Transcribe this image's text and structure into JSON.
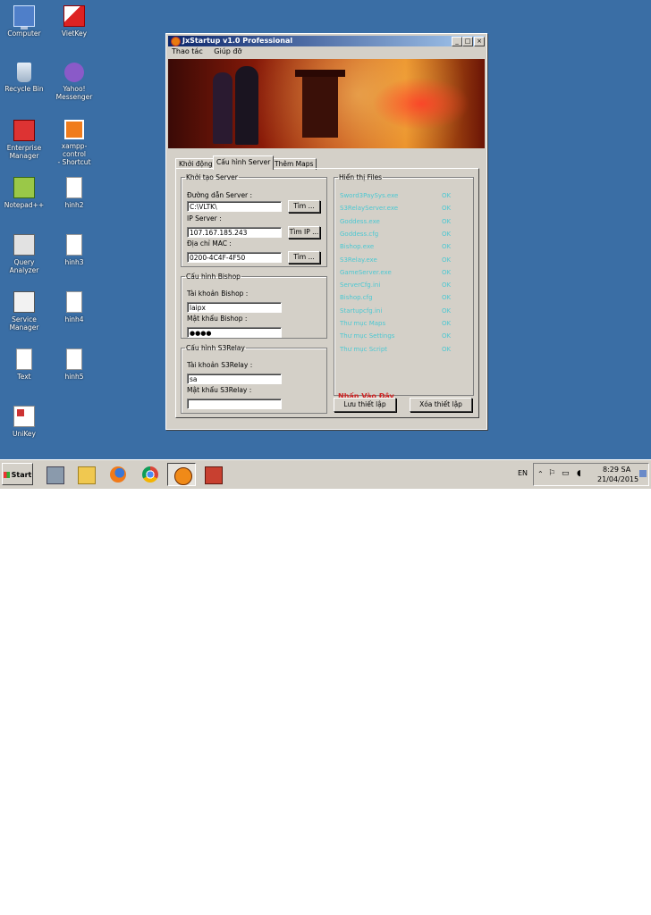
{
  "desktop_icons": [
    {
      "label": "Computer",
      "icon": "computer-icon"
    },
    {
      "label": "VietKey",
      "icon": "vietkey-icon"
    },
    {
      "label": "Recycle Bin",
      "icon": "recycle-bin-icon"
    },
    {
      "label": "Yahoo!\nMessenger",
      "icon": "yahoo-messenger-icon"
    },
    {
      "label": "Enterprise\nManager",
      "icon": "enterprise-manager-icon"
    },
    {
      "label": "xampp-control\n- Shortcut",
      "icon": "xampp-icon"
    },
    {
      "label": "Notepad++",
      "icon": "notepad-plus-plus-icon"
    },
    {
      "label": "hinh2",
      "icon": "document-icon"
    },
    {
      "label": "Query\nAnalyzer",
      "icon": "query-analyzer-icon"
    },
    {
      "label": "hinh3",
      "icon": "document-icon"
    },
    {
      "label": "Service\nManager",
      "icon": "service-manager-icon"
    },
    {
      "label": "hinh4",
      "icon": "document-icon"
    },
    {
      "label": "Text",
      "icon": "text-file-icon"
    },
    {
      "label": "hinh5",
      "icon": "document-icon"
    },
    {
      "label": "UniKey",
      "icon": "unikey-icon"
    }
  ],
  "window": {
    "title": "JxStartup v1.0 Professional",
    "menu": [
      "Thao tác",
      "Giúp đỡ"
    ],
    "tabs": [
      "Khởi động",
      "Cấu hình Server",
      "Thêm Maps"
    ],
    "active_tab": "Cấu hình Server"
  },
  "khoi_tao": {
    "legend": "Khởi tạo Server",
    "path_label": "Đường dẫn Server :",
    "path_value": "C:\\VLTK\\",
    "ip_label": "IP Server :",
    "ip_value": "107.167.185.243",
    "mac_label": "Địa chỉ MAC :",
    "mac_value": "0200-4C4F-4F50",
    "find_button": "Tìm ...",
    "find_ip_button": "Tìm IP ...",
    "find_mac_button": "Tìm ..."
  },
  "bishop": {
    "legend": "Cấu hình Bishop",
    "account_label": "Tài khoản Bishop :",
    "account_value": "laipx",
    "password_label": "Mật khẩu Bishop :",
    "password_value": "●●●●"
  },
  "s3relay": {
    "legend": "Cấu hình S3Relay",
    "account_label": "Tài khoản S3Relay :",
    "account_value": "sa",
    "password_label": "Mật khẩu S3Relay :",
    "password_value": ""
  },
  "files": {
    "legend": "Hiển thị Files",
    "items": [
      {
        "name": "Sword3PaySys.exe",
        "status": "OK"
      },
      {
        "name": "S3RelayServer.exe",
        "status": "OK"
      },
      {
        "name": "Goddess.exe",
        "status": "OK"
      },
      {
        "name": "Goddess.cfg",
        "status": "OK"
      },
      {
        "name": "Bishop.exe",
        "status": "OK"
      },
      {
        "name": "S3Relay.exe",
        "status": "OK"
      },
      {
        "name": "GameServer.exe",
        "status": "OK"
      },
      {
        "name": "ServerCfg.ini",
        "status": "OK"
      },
      {
        "name": "Bishop.cfg",
        "status": "OK"
      },
      {
        "name": "Startupcfg.ini",
        "status": "OK"
      },
      {
        "name": "Thư mục Maps",
        "status": "OK"
      },
      {
        "name": "Thư mục Settings",
        "status": "OK"
      },
      {
        "name": "Thư mục Script",
        "status": "OK"
      }
    ],
    "link": "Nhấn Vào Đây"
  },
  "actions": {
    "save": "Lưu thiết lập",
    "delete": "Xóa thiết lập"
  },
  "taskbar": {
    "start": "Start",
    "language": "EN",
    "time": "8:29 SA",
    "date": "21/04/2015"
  },
  "colors": {
    "desktop": "#3a6ea5",
    "file_list_text": "#4dc8d2",
    "link": "#d02020"
  }
}
